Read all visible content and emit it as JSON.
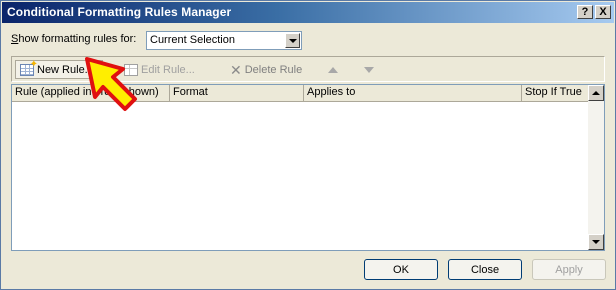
{
  "window": {
    "title": "Conditional Formatting Rules Manager",
    "help_glyph": "?",
    "close_glyph": "X"
  },
  "scope": {
    "label_prefix": "S",
    "label_rest": "how formatting rules for:",
    "selected": "Current Selection"
  },
  "toolbar": {
    "new_rule": "New Rule...",
    "edit_rule": "Edit Rule...",
    "delete_rule": "Delete Rule"
  },
  "grid": {
    "columns": [
      "Rule (applied in order shown)",
      "Format",
      "Applies to",
      "Stop If True"
    ],
    "rows": []
  },
  "footer": {
    "ok": "OK",
    "close": "Close",
    "apply": "Apply"
  },
  "colors": {
    "title_bar_start": "#0a246a",
    "dialog_bg": "#ece9d8",
    "pointer_fill": "#ffee00",
    "pointer_outline": "#e01010"
  },
  "icons": {
    "new_rule": "new-table-icon",
    "edit_rule": "edit-table-icon",
    "delete_rule": "delete-x-icon",
    "move_up": "triangle-up-icon",
    "move_down": "triangle-down-icon"
  }
}
